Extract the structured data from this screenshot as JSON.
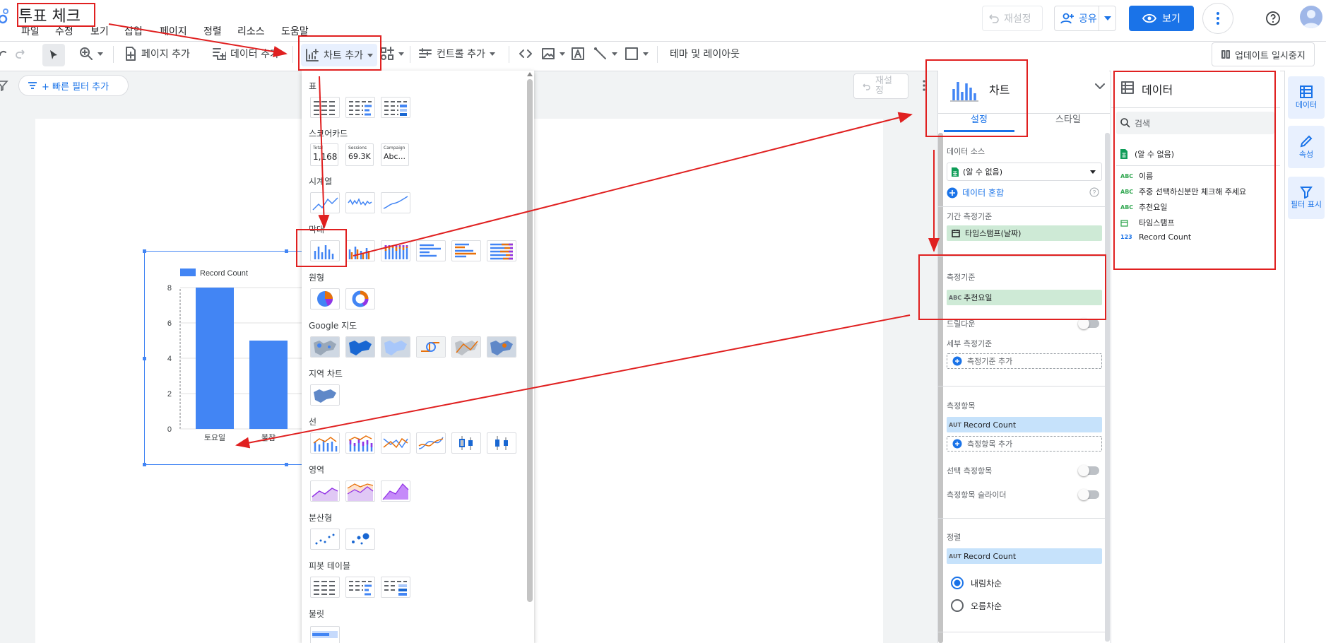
{
  "header": {
    "title": "투표 체크",
    "menu": [
      "파일",
      "수정",
      "보기",
      "삽입",
      "페이지",
      "정렬",
      "리소스",
      "도움말"
    ],
    "reset_label": "재설정",
    "share_label": "공유",
    "view_label": "보기"
  },
  "toolbar": {
    "add_page": "페이지 추가",
    "add_data": "데이터 추가",
    "add_chart": "차트 추가",
    "add_control": "컨트롤 추가",
    "theme_layout": "테마 및 레이아웃",
    "pause_update": "업데이트 일시중지"
  },
  "filterbar": {
    "quick_filter": "+ 빠른 필터 추가",
    "reset_label": "재설정"
  },
  "chart_menu": {
    "sections": [
      "표",
      "스코어카드",
      "시계열",
      "막대",
      "원형",
      "Google 지도",
      "지역 차트",
      "선",
      "영역",
      "분산형",
      "피봇 테이블",
      "불릿"
    ],
    "scorecards": [
      {
        "label": "Total",
        "value": "1,168"
      },
      {
        "label": "Sessions",
        "value": "69.3K"
      },
      {
        "label": "Campaign",
        "value": "Abc..."
      }
    ]
  },
  "chart_data": {
    "type": "bar",
    "legend": "Record Count",
    "categories": [
      "토요일",
      "불참"
    ],
    "values": [
      8,
      5
    ],
    "yticks": [
      "0",
      "2",
      "4",
      "6",
      "8"
    ],
    "ylim": [
      0,
      8
    ]
  },
  "setup_panel": {
    "title": "차트",
    "tab_setup": "설정",
    "tab_style": "스타일",
    "data_source_label": "데이터 소스",
    "data_source": "(알 수 없음)",
    "blend": "데이터 혼합",
    "date_range_label": "기간 측정기준",
    "date_range": "타임스탬프(날짜)",
    "dimension_label": "측정기준",
    "dimension": "추천요일",
    "drilldown": "드릴다운",
    "sub_dimension_label": "세부 측정기준",
    "add_dimension": "측정기준 추가",
    "metric_label": "측정항목",
    "metric": "Record Count",
    "add_metric": "측정항목 추가",
    "optional_metrics": "선택 측정항목",
    "metric_slider": "측정항목 슬라이더",
    "sort_label": "정렬",
    "sort_field": "Record Count",
    "desc": "내림차순",
    "asc": "오름차순",
    "aut": "AUT",
    "abc": "ABC"
  },
  "data_panel": {
    "title": "데이터",
    "search": "검색",
    "source": "(알 수 없음)",
    "fields": [
      {
        "type": "ABC",
        "name": "이름"
      },
      {
        "type": "ABC",
        "name": "주중 선택하신분만 체크해 주세요"
      },
      {
        "type": "ABC",
        "name": "추천요일"
      },
      {
        "type": "date",
        "name": "타임스탬프"
      },
      {
        "type": "123",
        "name": "Record Count"
      }
    ]
  },
  "rail": {
    "data": "데이터",
    "props": "속성",
    "filter": "필터 표시"
  }
}
